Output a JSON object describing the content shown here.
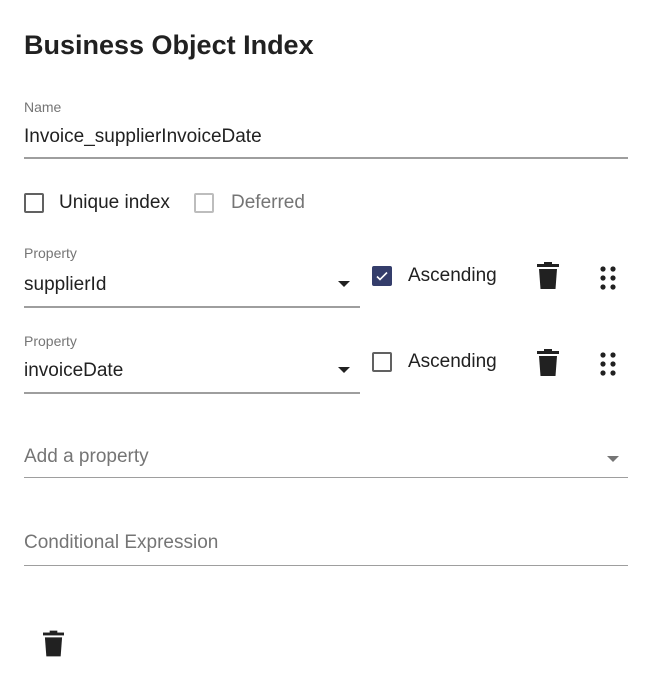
{
  "title": "Business Object Index",
  "name_field": {
    "label": "Name",
    "value": "Invoice_supplierInvoiceDate"
  },
  "options": {
    "unique_label": "Unique index",
    "unique_checked": false,
    "deferred_label": "Deferred",
    "deferred_checked": false,
    "deferred_disabled": true
  },
  "properties": [
    {
      "label": "Property",
      "value": "supplierId",
      "ascending_label": "Ascending",
      "ascending": true
    },
    {
      "label": "Property",
      "value": "invoiceDate",
      "ascending_label": "Ascending",
      "ascending": false
    }
  ],
  "add_property": {
    "placeholder": "Add a property"
  },
  "conditional": {
    "placeholder": "Conditional Expression"
  },
  "colors": {
    "accent": "#343d6b"
  },
  "icons": [
    "trash-icon",
    "drag-handle-icon",
    "chevron-down-icon",
    "check-icon"
  ]
}
